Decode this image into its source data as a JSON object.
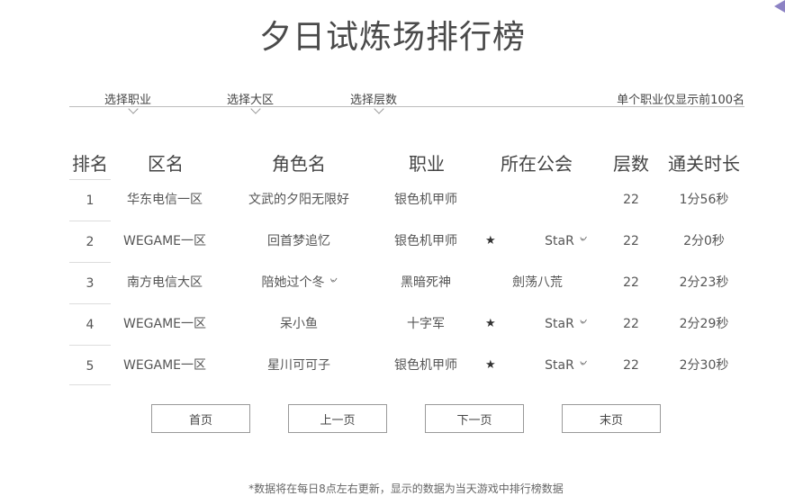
{
  "title": "夕日试炼场排行榜",
  "filters": {
    "job": "选择职业",
    "zone": "选择大区",
    "floor": "选择层数",
    "note": "单个职业仅显示前100名"
  },
  "headers": [
    "排名",
    "区名",
    "角色名",
    "职业",
    "所在公会",
    "层数",
    "通关时长"
  ],
  "rows": [
    {
      "rank": "1",
      "zone": "华东电信一区",
      "name": "文武的夕阳无限好",
      "job": "银色机甲师",
      "star": "",
      "guild": "",
      "floor": "22",
      "time": "1分56秒"
    },
    {
      "rank": "2",
      "zone": "WEGAME一区",
      "name": "回首梦追忆",
      "job": "银色机甲师",
      "star": "★",
      "guild": "StaR ৺",
      "floor": "22",
      "time": "2分0秒"
    },
    {
      "rank": "3",
      "zone": "南方电信大区",
      "name": "陪她过个冬 ৺",
      "job": "黑暗死神",
      "star": "",
      "guild": "劍荡八荒",
      "floor": "22",
      "time": "2分23秒"
    },
    {
      "rank": "4",
      "zone": "WEGAME一区",
      "name": "呆小鱼",
      "job": "十字军",
      "star": "★",
      "guild": "StaR ৺",
      "floor": "22",
      "time": "2分29秒"
    },
    {
      "rank": "5",
      "zone": "WEGAME一区",
      "name": "星川可可子",
      "job": "银色机甲师",
      "star": "★",
      "guild": "StaR ৺",
      "floor": "22",
      "time": "2分30秒"
    }
  ],
  "pagination": {
    "first": "首页",
    "prev": "上一页",
    "next": "下一页",
    "last": "末页"
  },
  "footer": "*数据将在每日8点左右更新，显示的数据为当天游戏中排行榜数据"
}
